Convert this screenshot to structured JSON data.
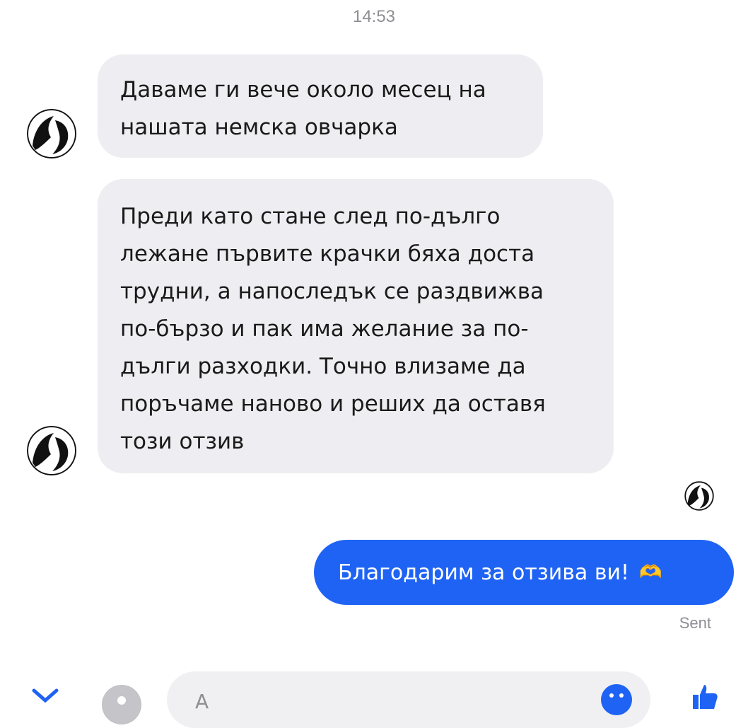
{
  "chat": {
    "timestamp": "14:53",
    "incoming": [
      {
        "lines": [
          "Даваме ги вече около месец на",
          "нашата немска овчарка"
        ]
      },
      {
        "lines": [
          "Преди като стане след по-дълго",
          "лежане първите крачки бяха доста",
          "трудни, а напоследък се раздвижва",
          "по-бързо и пак има желание за по-",
          "дълги разходки. Точно влизаме да",
          "поръчаме наново и реших да оставя",
          "този отзив"
        ]
      }
    ],
    "outgoing": {
      "text": "Благодарим за отзива ви!",
      "emoji": "🫶"
    },
    "status": "Sent"
  },
  "composer": {
    "placeholder": "A"
  },
  "icons": {
    "avatar": "avatar-icon",
    "read_receipt": "read-receipt-avatar-icon",
    "arrow": "expand-arrow-icon",
    "camera": "camera-icon",
    "emoji": "emoji-icon",
    "like": "thumbs-up-icon"
  },
  "colors": {
    "incoming_bubble": "#eeeef2",
    "outgoing_bubble": "#1f63f4",
    "muted_text": "#8e8e93",
    "accent": "#1f63f4"
  }
}
